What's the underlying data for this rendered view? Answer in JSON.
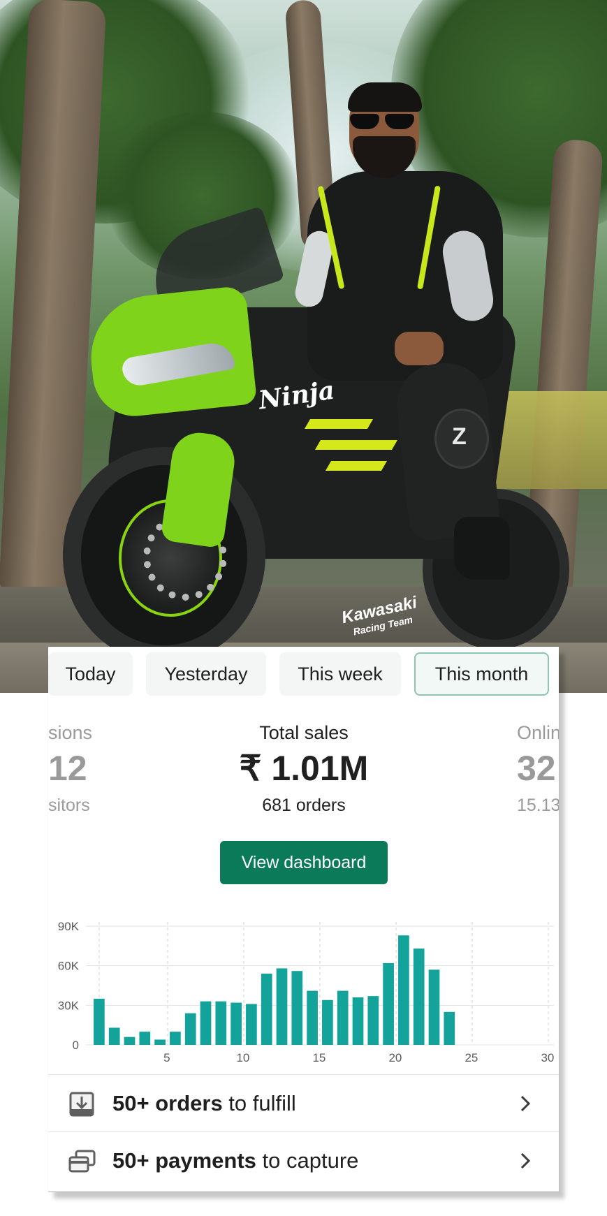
{
  "hero": {
    "brand_text_1": "Ninja",
    "brand_text_2": "Kawasaki",
    "brand_text_3": "Racing Team",
    "knee_logo": "Z"
  },
  "tabs": [
    {
      "label": "Today",
      "selected": false
    },
    {
      "label": "Yesterday",
      "selected": false
    },
    {
      "label": "This week",
      "selected": false
    },
    {
      "label": "This month",
      "selected": true
    }
  ],
  "metrics": {
    "left": {
      "label": "sions",
      "value": "12",
      "sub": "sitors"
    },
    "center": {
      "label": "Total sales",
      "value": "₹ 1.01M",
      "sub": "681 orders"
    },
    "right": {
      "label": "Onlin",
      "value": "32",
      "sub": "15.13"
    }
  },
  "actions": {
    "view_dashboard": "View dashboard"
  },
  "chart_data": {
    "type": "bar",
    "x": [
      1,
      2,
      3,
      4,
      5,
      6,
      7,
      8,
      9,
      10,
      11,
      12,
      13,
      14,
      15,
      16,
      17,
      18,
      19,
      20,
      21,
      22,
      23,
      24,
      25,
      26,
      27,
      28,
      29,
      30
    ],
    "values": [
      35000,
      13000,
      6000,
      10000,
      4000,
      10000,
      24000,
      33000,
      33000,
      32000,
      31000,
      54000,
      58000,
      56000,
      41000,
      34000,
      41000,
      36000,
      37000,
      62000,
      83000,
      73000,
      57000,
      25000
    ],
    "series_values": [
      35000,
      13000,
      6000,
      10000,
      4000,
      10000,
      24000,
      33000,
      33000,
      32000,
      31000,
      54000,
      58000,
      56000,
      41000,
      34000,
      41000,
      36000,
      37000,
      62000,
      83000,
      73000,
      57000,
      25000
    ],
    "xticks": [
      "5",
      "10",
      "15",
      "20",
      "25",
      "30"
    ],
    "yticks": [
      "0",
      "30K",
      "60K",
      "90K"
    ],
    "ylim": [
      0,
      90000
    ],
    "grid": true,
    "color": "#13a39b"
  },
  "tasks": [
    {
      "bold": "50+ orders",
      "rest": " to fulfill",
      "icon": "download-tray-icon"
    },
    {
      "bold": "50+ payments",
      "rest": " to capture",
      "icon": "credit-card-icon"
    }
  ],
  "colors": {
    "accent": "#0b7a58",
    "bar": "#13a39b",
    "tab_active_border": "#8fc3b3"
  }
}
